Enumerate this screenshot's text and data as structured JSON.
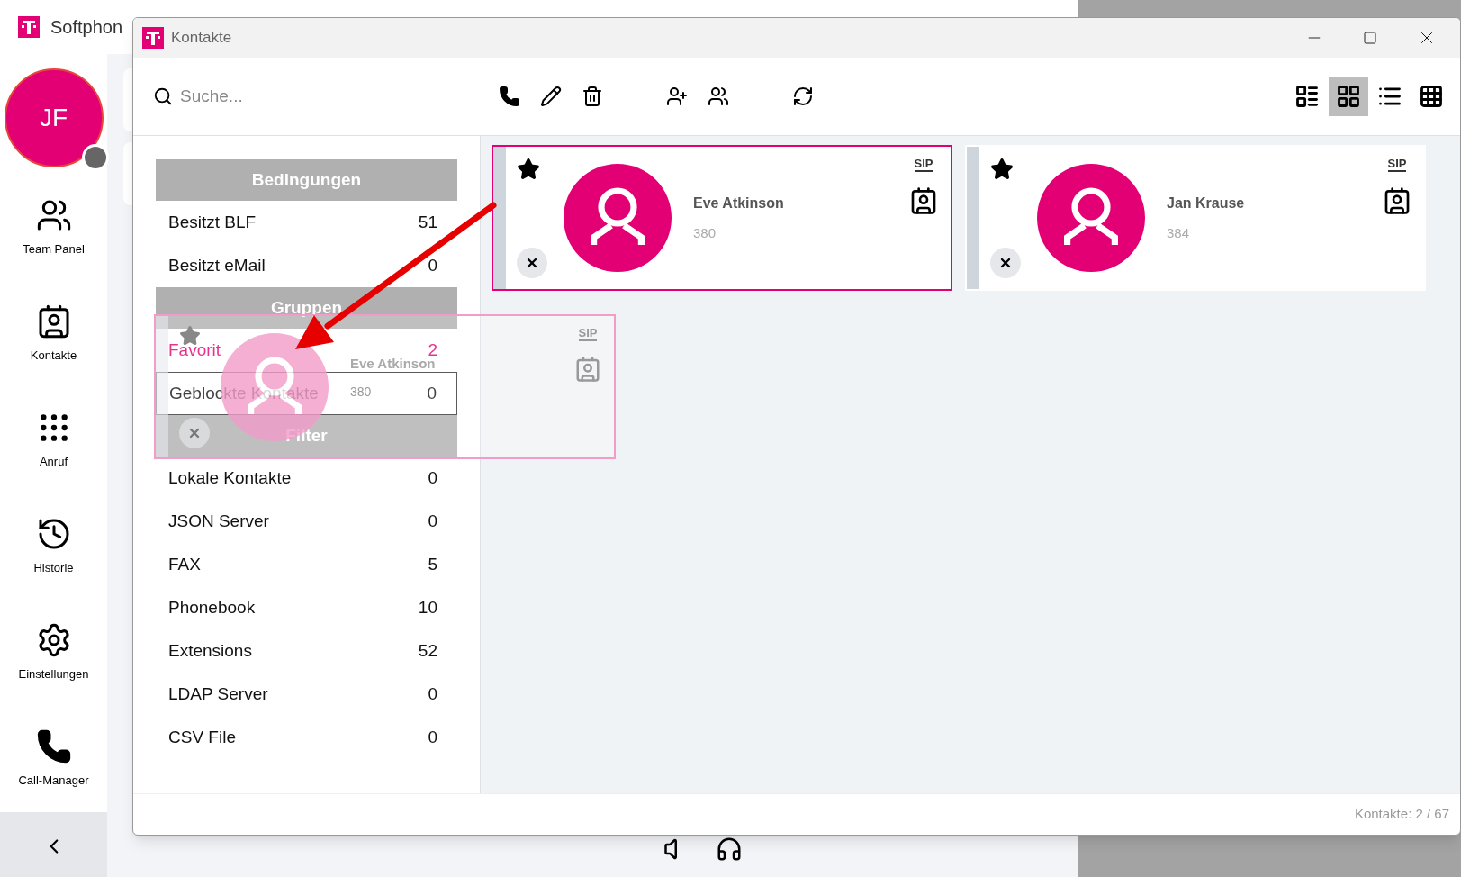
{
  "app": {
    "title": "Softphon",
    "user": {
      "initials": "JF",
      "online": false
    },
    "nav": [
      {
        "kind": "team",
        "label": "Team Panel"
      },
      {
        "kind": "contacts",
        "label": "Kontakte"
      },
      {
        "kind": "dialpad",
        "label": "Anruf"
      },
      {
        "kind": "history",
        "label": "Historie"
      },
      {
        "kind": "settings",
        "label": "Einstellungen"
      },
      {
        "kind": "phone",
        "label": "Call-Manager"
      }
    ]
  },
  "dialog": {
    "title": "Kontakte",
    "search": {
      "placeholder": "Suche..."
    },
    "view_modes": [
      {
        "kind": "list-detail",
        "selected": false
      },
      {
        "kind": "grid-detail",
        "selected": true
      },
      {
        "kind": "list",
        "selected": false
      },
      {
        "kind": "grid",
        "selected": false
      }
    ],
    "groups": [
      {
        "title": "Bedingungen",
        "items": [
          {
            "label": "Besitzt BLF",
            "count": "51",
            "selected": false,
            "focused": false
          },
          {
            "label": "Besitzt eMail",
            "count": "0",
            "selected": false,
            "focused": false
          }
        ]
      },
      {
        "title": "Gruppen",
        "items": [
          {
            "label": "Favorit",
            "count": "2",
            "selected": true,
            "focused": false
          },
          {
            "label": "Geblockte Kontakte",
            "count": "0",
            "selected": false,
            "focused": true
          }
        ]
      },
      {
        "title": "Filter",
        "items": [
          {
            "label": "Lokale Kontakte",
            "count": "0",
            "selected": false,
            "focused": false
          },
          {
            "label": "JSON Server",
            "count": "0",
            "selected": false,
            "focused": false
          },
          {
            "label": "FAX",
            "count": "5",
            "selected": false,
            "focused": false
          },
          {
            "label": "Phonebook",
            "count": "10",
            "selected": false,
            "focused": false
          },
          {
            "label": "Extensions",
            "count": "52",
            "selected": false,
            "focused": false
          },
          {
            "label": "LDAP Server",
            "count": "0",
            "selected": false,
            "focused": false
          },
          {
            "label": "CSV File",
            "count": "0",
            "selected": false,
            "focused": false
          }
        ]
      }
    ],
    "cards": [
      {
        "name": "Eve Atkinson",
        "number": "380",
        "badge": "SIP",
        "favorite": true,
        "selected": true
      },
      {
        "name": "Jan Krause",
        "number": "384",
        "badge": "SIP",
        "favorite": true,
        "selected": false
      }
    ],
    "drag_preview": {
      "name": "Eve Atkinson",
      "number": "380",
      "badge": "SIP"
    },
    "status": "Kontakte: 2 / 67"
  }
}
